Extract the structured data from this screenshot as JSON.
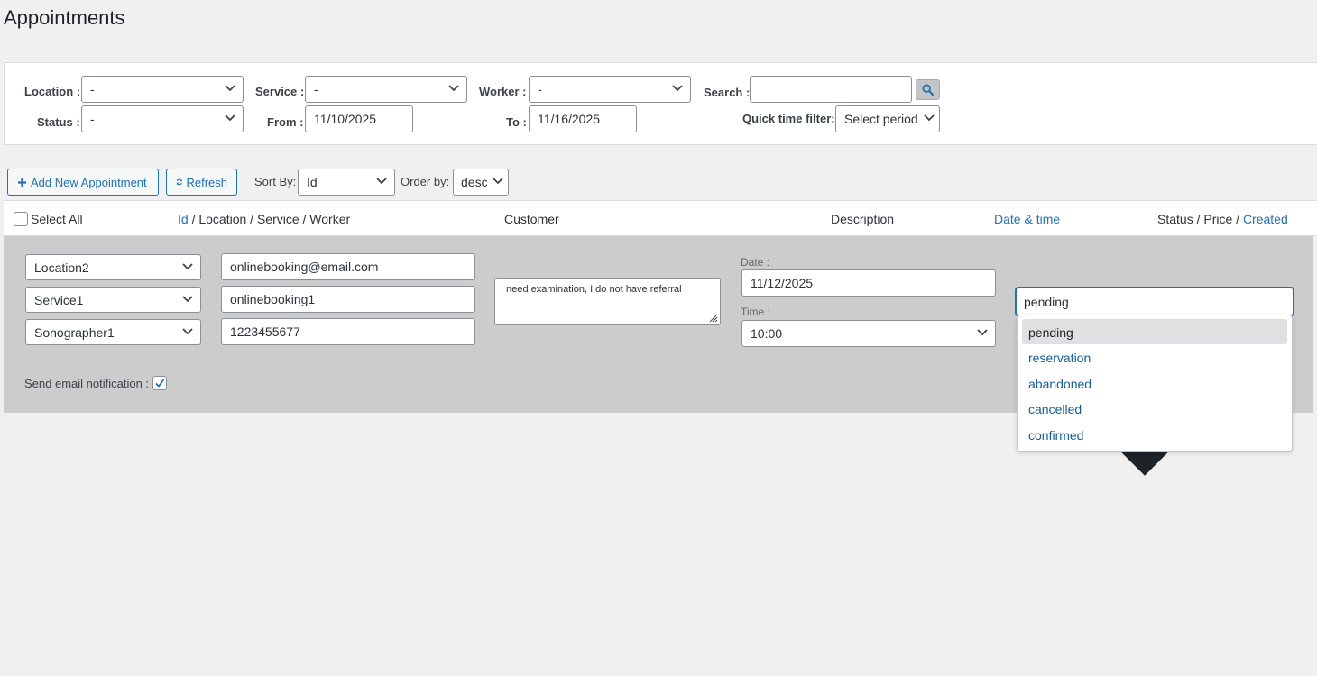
{
  "page": {
    "title": "Appointments"
  },
  "filters": {
    "location_label": "Location :",
    "location_value": "-",
    "service_label": "Service :",
    "service_value": "-",
    "worker_label": "Worker :",
    "worker_value": "-",
    "search_label": "Search :",
    "search_value": "",
    "status_label": "Status :",
    "status_value": "-",
    "from_label": "From :",
    "from_value": "11/10/2025",
    "to_label": "To :",
    "to_value": "11/16/2025",
    "quick_label": "Quick time filter:",
    "quick_value": "Select period"
  },
  "toolbar": {
    "add_label": "Add New Appointment",
    "refresh_label": "Refresh",
    "sort_label": "Sort By:",
    "sort_value": "Id",
    "order_label": "Order by:",
    "order_value": "desc"
  },
  "table": {
    "select_all": "Select All",
    "col_id": "Id",
    "col_id_rest": " / Location / Service / Worker",
    "col_customer": "Customer",
    "col_description": "Description",
    "col_datetime": "Date & time",
    "col_status": "Status / Price / ",
    "col_created": "Created"
  },
  "edit": {
    "location": "Location2",
    "service": "Service1",
    "worker": "Sonographer1",
    "email": "onlinebooking@email.com",
    "name": "onlinebooking1",
    "phone": "1223455677",
    "description": "I need examination, I do not have referral",
    "date_label": "Date :",
    "date_value": "11/12/2025",
    "time_label": "Time :",
    "time_value": "10:00",
    "status_value": "pending",
    "notify_label": "Send email notification :",
    "notify_checked": true
  },
  "status_options": [
    "pending",
    "reservation",
    "abandoned",
    "cancelled",
    "confirmed"
  ],
  "colors": {
    "accent": "#2271b1",
    "row_bg": "#cccccc",
    "page_bg": "#f0f0f1"
  }
}
